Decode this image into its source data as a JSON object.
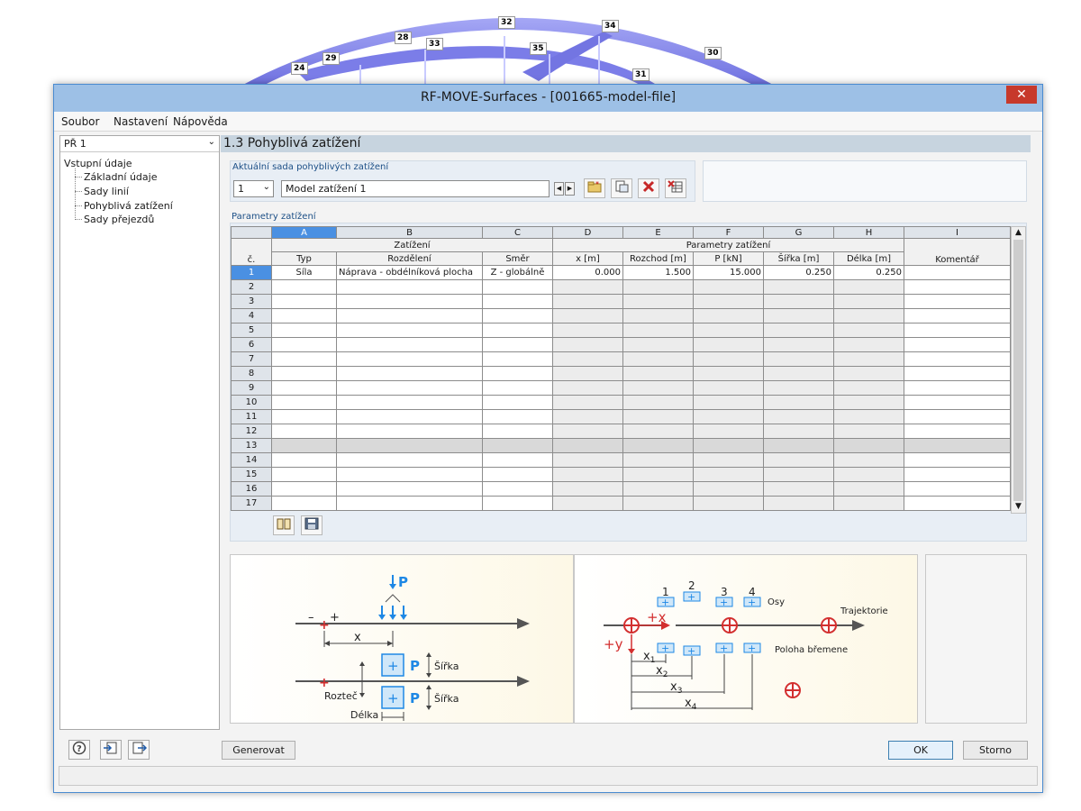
{
  "background_nodes": [
    "24",
    "29",
    "28",
    "33",
    "32",
    "35",
    "34",
    "31",
    "30"
  ],
  "window": {
    "title": "RF-MOVE-Surfaces - [001665-model-file]",
    "close": "✕"
  },
  "menu": [
    "Soubor",
    "Nastavení",
    "Nápověda"
  ],
  "sidebar": {
    "case": "PŘ 1",
    "root": "Vstupní údaje",
    "items": [
      "Základní údaje",
      "Sady linií",
      "Pohyblivá zatížení",
      "Sady přejezdů"
    ]
  },
  "section_title": "1.3 Pohyblivá zatížení",
  "moving_load_set": {
    "label": "Aktuální sada pohyblivých zatížení",
    "number": "1",
    "name": "Model zatížení 1"
  },
  "params": {
    "label": "Parametry zatížení",
    "col_letters": [
      "A",
      "B",
      "C",
      "D",
      "E",
      "F",
      "G",
      "H",
      "I"
    ],
    "group_load": "Zatížení",
    "group_params": "Parametry zatížení",
    "headers": [
      "č.",
      "Typ",
      "Rozdělení",
      "Směr",
      "x [m]",
      "Rozchod [m]",
      "P [kN]",
      "Šířka [m]",
      "Délka [m]",
      "Komentář"
    ],
    "rows": [
      [
        "1",
        "Síla",
        "Náprava - obdélníková plocha",
        "Z - globálně",
        "0.000",
        "1.500",
        "15.000",
        "0.250",
        "0.250",
        ""
      ],
      [
        "2",
        "",
        "",
        "",
        "",
        "",
        "",
        "",
        "",
        ""
      ],
      [
        "3",
        "",
        "",
        "",
        "",
        "",
        "",
        "",
        "",
        ""
      ],
      [
        "4",
        "",
        "",
        "",
        "",
        "",
        "",
        "",
        "",
        ""
      ],
      [
        "5",
        "",
        "",
        "",
        "",
        "",
        "",
        "",
        "",
        ""
      ],
      [
        "6",
        "",
        "",
        "",
        "",
        "",
        "",
        "",
        "",
        ""
      ],
      [
        "7",
        "",
        "",
        "",
        "",
        "",
        "",
        "",
        "",
        ""
      ],
      [
        "8",
        "",
        "",
        "",
        "",
        "",
        "",
        "",
        "",
        ""
      ],
      [
        "9",
        "",
        "",
        "",
        "",
        "",
        "",
        "",
        "",
        ""
      ],
      [
        "10",
        "",
        "",
        "",
        "",
        "",
        "",
        "",
        "",
        ""
      ],
      [
        "11",
        "",
        "",
        "",
        "",
        "",
        "",
        "",
        "",
        ""
      ],
      [
        "12",
        "",
        "",
        "",
        "",
        "",
        "",
        "",
        "",
        ""
      ],
      [
        "13",
        "",
        "",
        "",
        "",
        "",
        "",
        "",
        "",
        ""
      ],
      [
        "14",
        "",
        "",
        "",
        "",
        "",
        "",
        "",
        "",
        ""
      ],
      [
        "15",
        "",
        "",
        "",
        "",
        "",
        "",
        "",
        "",
        ""
      ],
      [
        "16",
        "",
        "",
        "",
        "",
        "",
        "",
        "",
        "",
        ""
      ],
      [
        "17",
        "",
        "",
        "",
        "",
        "",
        "",
        "",
        "",
        ""
      ]
    ],
    "selected_row": "1",
    "highlight_row": "13"
  },
  "diagram_left": {
    "p": "P",
    "x": "x",
    "sirka": "Šířka",
    "roztec": "Rozteč",
    "delka": "Délka",
    "minus": "–",
    "plus": "+"
  },
  "diagram_right": {
    "axes": [
      "1",
      "2",
      "3",
      "4"
    ],
    "osy": "Osy",
    "trajektorie": "Trajektorie",
    "poloha": "Poloha břemene",
    "plus_x": "+x",
    "plus_y": "+y",
    "x_labels": [
      "x",
      "x",
      "x",
      "x"
    ],
    "x_subs": [
      "1",
      "2",
      "3",
      "4"
    ]
  },
  "footer": {
    "generate": "Generovat",
    "ok": "OK",
    "cancel": "Storno"
  },
  "colors": {
    "title_bar": "#9dc0e6",
    "selection": "#4a90e2",
    "arch": "#8d8ff0",
    "close": "#c7392b"
  }
}
